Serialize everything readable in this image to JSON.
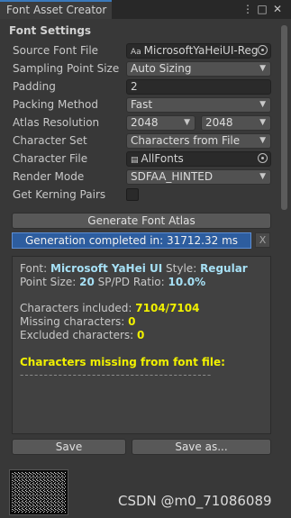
{
  "window": {
    "tab_title": "Font Asset Creator",
    "icons": [
      "menu-dots-icon",
      "maximize-icon",
      "close-icon"
    ]
  },
  "settings": {
    "section_title": "Font Settings",
    "source_font_label": "Source Font File",
    "source_font_value": "MicrosoftYaHeiUI-Reg",
    "source_font_icon_text": "Aa",
    "sampling_label": "Sampling Point Size",
    "sampling_value": "Auto Sizing",
    "padding_label": "Padding",
    "padding_value": "2",
    "packing_label": "Packing Method",
    "packing_value": "Fast",
    "atlas_label": "Atlas Resolution",
    "atlas_width": "2048",
    "atlas_height": "2048",
    "charset_label": "Character Set",
    "charset_value": "Characters from File",
    "charfile_label": "Character File",
    "charfile_value": "AllFonts",
    "render_label": "Render Mode",
    "render_value": "SDFAA_HINTED",
    "kerning_label": "Get Kerning Pairs",
    "kerning_checked": false
  },
  "actions": {
    "generate_label": "Generate Font Atlas",
    "progress_text": "Generation completed in: 31712.32 ms",
    "progress_fraction": 1.0,
    "cancel_label": "X"
  },
  "info": {
    "font_label": "Font:",
    "font_value": "Microsoft YaHei UI",
    "style_label": "Style:",
    "style_value": "Regular",
    "point_size_label": "Point Size:",
    "point_size_value": "20",
    "ratio_label": "SP/PD Ratio:",
    "ratio_value": "10.0%",
    "included_label": "Characters included:",
    "included_value": "7104/7104",
    "missing_label": "Missing characters:",
    "missing_value": "0",
    "excluded_label": "Excluded characters:",
    "excluded_value": "0",
    "missing_header": "Characters missing from font file:",
    "divider": "----------------------------------------"
  },
  "footer": {
    "save_label": "Save",
    "save_as_label": "Save as..."
  },
  "watermark": "CSDN @m0_71086089",
  "colors": {
    "background": "#383838",
    "progress_fill": "#2d5d9f",
    "highlight_cyan": "#a6e0f5",
    "highlight_yellow": "#f0f000",
    "tab_accent": "#3a79bb"
  }
}
